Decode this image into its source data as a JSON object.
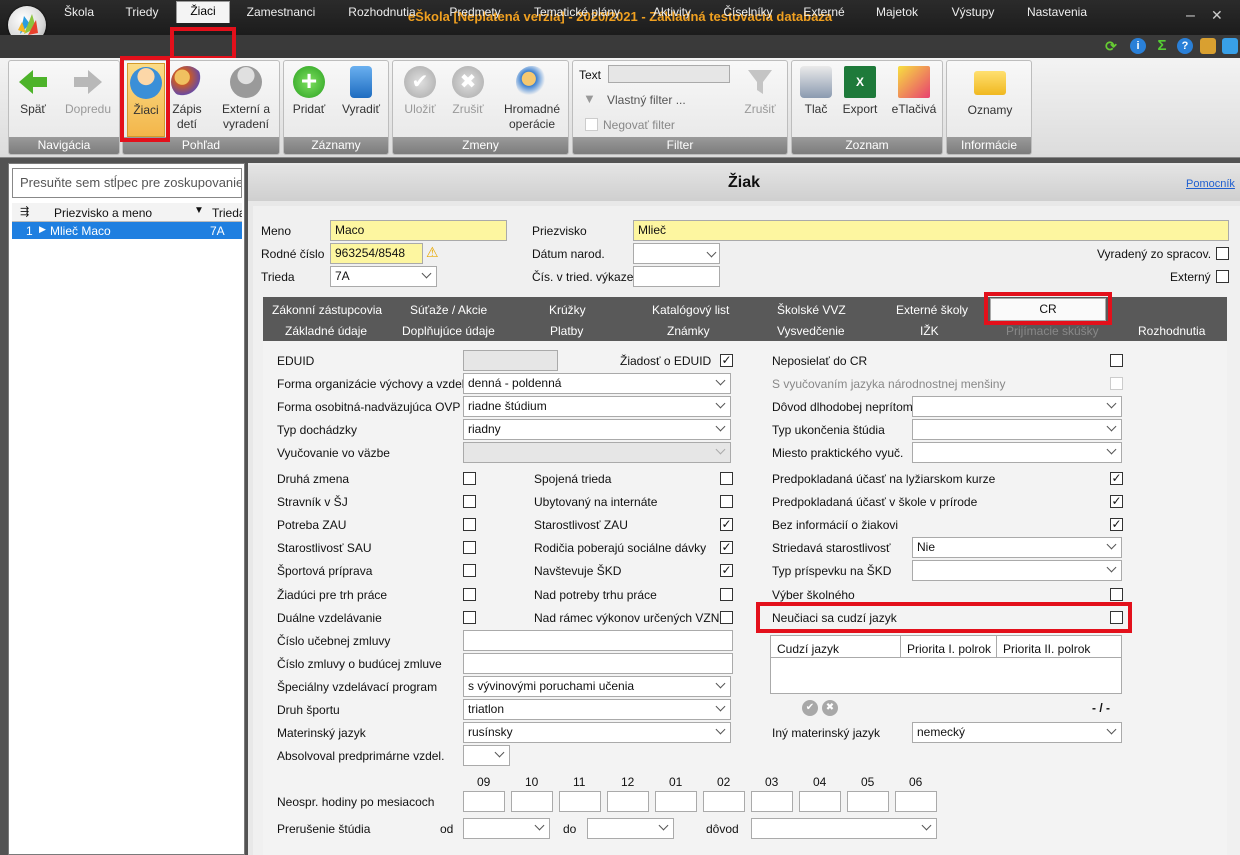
{
  "title": "eŠkola [Neplatená verzia] - 2020/2021 - Základná testovacia databaza",
  "menu": [
    "Škola",
    "Triedy",
    "Žiaci",
    "Zamestnanci",
    "Rozhodnutia",
    "Predmety",
    "Tematické plány",
    "Aktivity",
    "Číselníky",
    "Externé",
    "Majetok",
    "Výstupy",
    "Nastavenia"
  ],
  "ribbon": {
    "nav": {
      "label": "Navigácia",
      "back": "Späť",
      "forward": "Dopredu"
    },
    "view": {
      "label": "Pohľad",
      "students": "Žiaci",
      "enroll": "Zápis detí",
      "external": "Externí a vyradení"
    },
    "records": {
      "label": "Záznamy",
      "add": "Pridať",
      "remove": "Vyradiť"
    },
    "changes": {
      "label": "Zmeny",
      "save": "Uložiť",
      "cancel": "Zrušiť",
      "bulk": "Hromadné operácie"
    },
    "filter": {
      "label": "Filter",
      "text_label": "Text",
      "custom": "Vlastný filter ...",
      "negate": "Negovať filter",
      "cancel": "Zrušiť"
    },
    "list": {
      "label": "Zoznam",
      "print": "Tlač",
      "export": "Export",
      "eprint": "eTlačivá"
    },
    "info": {
      "label": "Informácie",
      "notices": "Oznamy"
    }
  },
  "left": {
    "group_hint": "Presuňte sem stĺpec pre zoskupovanie",
    "col_name": "Priezvisko a meno",
    "col_class": "Trieda",
    "row_num": "1",
    "row_name": "Mlieč Maco",
    "row_class": "7A"
  },
  "header": {
    "title": "Žiak",
    "help": "Pomocník"
  },
  "student": {
    "meno_label": "Meno",
    "meno": "Maco",
    "priezvisko_label": "Priezvisko",
    "priezvisko": "Mlieč",
    "rc_label": "Rodné číslo",
    "rc": "963254/8548",
    "datum_label": "Dátum narod.",
    "trieda_label": "Trieda",
    "trieda": "7A",
    "cis_label": "Čís. v tried. výkaze",
    "vyradeny": "Vyradený zo spracov.",
    "externy": "Externý"
  },
  "tabs_row1": [
    "Zákonní zástupcovia",
    "Súťaže / Akcie",
    "Krúžky",
    "Katalógový list",
    "Školské VVZ",
    "Externé školy",
    "CR"
  ],
  "tabs_row2": [
    "Základné údaje",
    "Doplňujúce údaje",
    "Platby",
    "Známky",
    "Vysvedčenie",
    "IŽK",
    "Prijímacie skúšky",
    "Rozhodnutia"
  ],
  "cr": {
    "eduid": "EDUID",
    "ziadost_eduid": "Žiadosť o EDUID",
    "forma_org": "Forma organizácie výchovy a vzdel.",
    "forma_org_val": "denná - poldenná",
    "forma_osob": "Forma osobitná-nadväzujúca OVP",
    "forma_osob_val": "riadne štúdium",
    "typ_doch": "Typ dochádzky",
    "typ_doch_val": "riadny",
    "vyuc_vazbe": "Vyučovanie vo väzbe",
    "c1": [
      "Druhá zmena",
      "Stravník v ŠJ",
      "Potreba ZAU",
      "Starostlivosť SAU",
      "Športová príprava",
      "Žiadúci pre trh práce",
      "Duálne vzdelávanie"
    ],
    "c2": [
      "Spojená trieda",
      "Ubytovaný na internáte",
      "Starostlivosť ZAU",
      "Rodičia poberajú sociálne dávky",
      "Navštevuje ŠKD",
      "Nad potreby trhu práce",
      "Nad rámec výkonov určených VZN"
    ],
    "cislo_ucebnej": "Číslo učebnej zmluvy",
    "cislo_buducej": "Číslo zmluvy o budúcej zmluve",
    "spec_program": "Špeciálny vzdelávací program",
    "spec_program_val": "s vývinovými poruchami učenia",
    "druh_sportu": "Druh športu",
    "druh_sportu_val": "triatlon",
    "materinsky": "Materinský jazyk",
    "materinsky_val": "rusínsky",
    "absolvoval": "Absolvoval predprimárne vzdel.",
    "months": [
      "09",
      "10",
      "11",
      "12",
      "01",
      "02",
      "03",
      "04",
      "05",
      "06"
    ],
    "neospr": "Neospr. hodiny po mesiacoch",
    "prerusenie": "Prerušenie štúdia",
    "od": "od",
    "do": "do",
    "dovod": "dôvod",
    "neposielat": "Neposielať do CR",
    "s_vyuc": "S vyučovaním jazyka národnostnej menšiny",
    "dovod_dlh": "Dôvod dlhodobej neprítom.",
    "typ_ukonc": "Typ ukončenia štúdia",
    "miesto_prakt": "Miesto praktického vyuč.",
    "c3": [
      "Predpokladaná účasť na lyžiarskom kurze",
      "Predpokladaná účasť v škole v prírode",
      "Bez informácií o žiakovi"
    ],
    "striedava": "Striedavá starostlivosť",
    "striedava_val": "Nie",
    "typ_prisp": "Typ príspevku na ŠKD",
    "vyber_skol": "Výber školného",
    "neuciaci": "Neučiaci sa cudzí jazyk",
    "lang_cols": [
      "Cudzí jazyk",
      "Priorita I. polrok",
      "Priorita II. polrok"
    ],
    "nav_counter": "- / -",
    "iny_mat": "Iný materinský jazyk",
    "iny_mat_val": "nemecký"
  }
}
